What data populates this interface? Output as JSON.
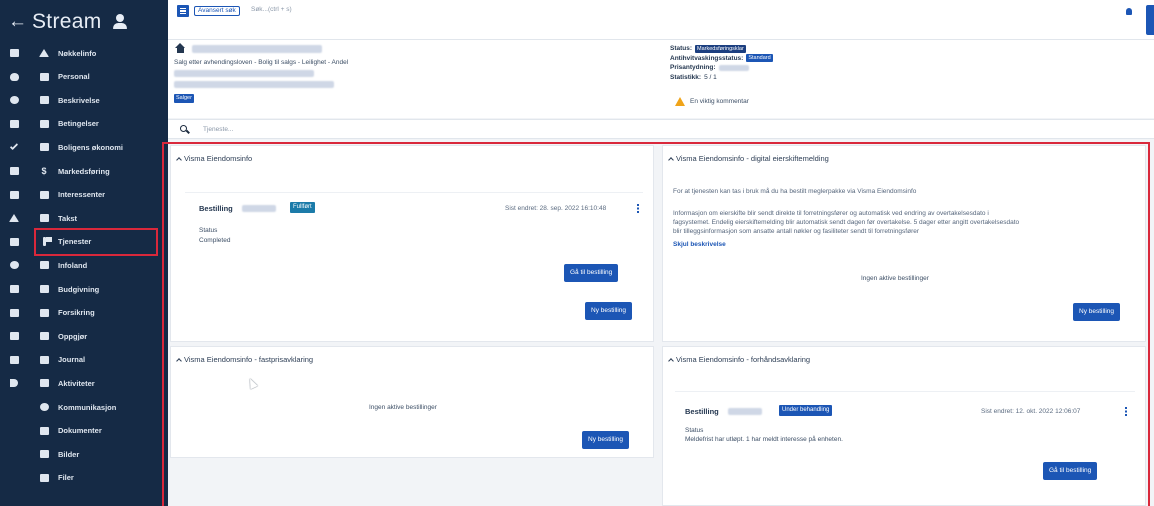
{
  "app": {
    "title": "Stream",
    "back_symbol": "←"
  },
  "sidebar": {
    "items": [
      {
        "label": "Nøkkelinfo",
        "outer_icon": "square-icon",
        "inner_icon": "home-icon"
      },
      {
        "label": "Personal",
        "outer_icon": "heart-icon",
        "inner_icon": "building-icon"
      },
      {
        "label": "Beskrivelse",
        "outer_icon": "chat-icon",
        "inner_icon": "square-outline-icon"
      },
      {
        "label": "Betingelser",
        "outer_icon": "grid-icon",
        "inner_icon": "id-card-icon"
      },
      {
        "label": "Boligens økonomi",
        "outer_icon": "check-icon",
        "inner_icon": "bank-icon"
      },
      {
        "label": "Markedsføring",
        "outer_icon": "table-icon",
        "inner_icon": "dollar-icon"
      },
      {
        "label": "Interessenter",
        "outer_icon": "person-icon",
        "inner_icon": "people-icon"
      },
      {
        "label": "Takst",
        "outer_icon": "home-icon",
        "inner_icon": "square-outline-icon"
      },
      {
        "label": "Tjenester",
        "outer_icon": "people-icon",
        "inner_icon": "flag-icon"
      },
      {
        "label": "Infoland",
        "outer_icon": "circle-icon",
        "inner_icon": "book-icon"
      },
      {
        "label": "Budgivning",
        "outer_icon": "id-card-icon",
        "inner_icon": "gavel-icon"
      },
      {
        "label": "Forsikring",
        "outer_icon": "car-icon",
        "inner_icon": "umbrella-icon"
      },
      {
        "label": "Oppgjør",
        "outer_icon": "person-icon",
        "inner_icon": "table-icon"
      },
      {
        "label": "Journal",
        "outer_icon": "book-icon",
        "inner_icon": "book-icon"
      },
      {
        "label": "Aktiviteter",
        "outer_icon": "logout-icon",
        "inner_icon": "grid-icon"
      },
      {
        "label": "Kommunikasjon",
        "outer_icon": "",
        "inner_icon": "chat-icon"
      },
      {
        "label": "Dokumenter",
        "outer_icon": "",
        "inner_icon": "document-icon"
      },
      {
        "label": "Bilder",
        "outer_icon": "",
        "inner_icon": "image-icon"
      },
      {
        "label": "Filer",
        "outer_icon": "",
        "inner_icon": "folder-icon"
      }
    ],
    "active_item": "Tjenester"
  },
  "topbar": {
    "advanced_search_label": "Avansert søk",
    "search_placeholder": "Søk...(ctrl + s)"
  },
  "property": {
    "subtitle": "Salg etter avhendingsloven - Bolig til salgs - Leilighet - Andel",
    "badge": "Salger",
    "status_label": "Status:",
    "status_value": "Markedsføringsklar",
    "antihvit_label": "Antihvitvaskingsstatus:",
    "antihvit_value": "Standard",
    "prisantydning_label": "Prisantydning:",
    "statistics_label": "Statistikk:",
    "statistics_value": "5 / 1",
    "warning": "En viktig kommentar"
  },
  "service_search": {
    "placeholder": "Tjeneste..."
  },
  "panels": {
    "visma_eiendomsinfo": {
      "title": "Visma Eiendomsinfo",
      "order_label": "Bestilling",
      "order_badge": "Fullført",
      "last_changed": "Sist endret: 28. sep. 2022 16:10:48",
      "status_label": "Status",
      "status_value": "Completed",
      "go_button": "Gå til bestilling",
      "new_button": "Ny bestilling"
    },
    "digital_eierskifte": {
      "title": "Visma Eiendomsinfo - digital eierskiftemelding",
      "intro": "For at tjenesten kan tas i bruk må du ha bestilt meglerpakke via Visma Eiendomsinfo",
      "desc1": "Informasjon om eierskifte blir sendt direkte til forretningsfører og automatisk ved endring av overtakelsesdato i",
      "desc2": "fagsystemet. Endelig eierskiftemelding blir automatisk sendt dagen før overtakelse. 5 dager etter angitt overtakelsesdato",
      "desc3": "blir tilleggsinformasjon som ansatte antall nøkler og fasiliteter sendt til forretningsfører",
      "hide_link": "Skjul beskrivelse",
      "empty": "Ingen aktive bestillinger",
      "new_button": "Ny bestilling"
    },
    "fastprisavklaring": {
      "title": "Visma Eiendomsinfo - fastprisavklaring",
      "empty": "Ingen aktive bestillinger",
      "new_button": "Ny bestilling"
    },
    "forhandsavklaring": {
      "title": "Visma Eiendomsinfo - forhåndsavklaring",
      "order_label": "Bestilling",
      "order_badge": "Under behandling",
      "last_changed": "Sist endret: 12. okt. 2022 12:06:07",
      "status_label": "Status",
      "status_value": "Meldefrist har utløpt. 1 har meldt interesse på enheten.",
      "go_button": "Gå til bestilling"
    }
  },
  "colors": {
    "sidebar_bg": "#152a45",
    "accent": "#1c56b5",
    "highlight": "#d9283b",
    "warning": "#f0a419"
  }
}
